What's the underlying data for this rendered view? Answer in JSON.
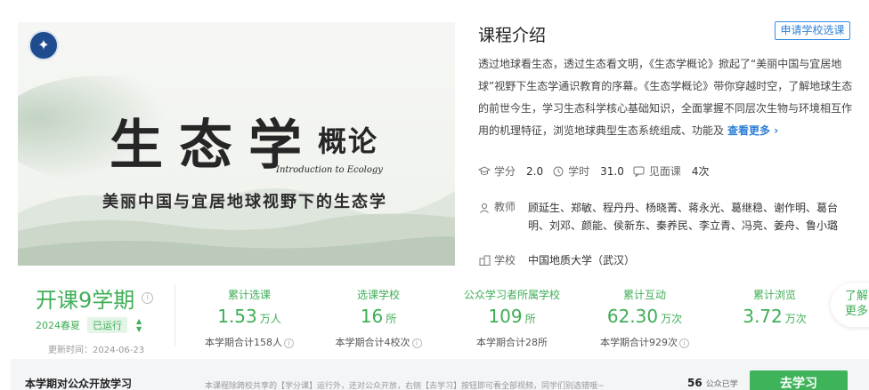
{
  "cover": {
    "logo_glyph": "✦",
    "title_main": "生态学",
    "title_small": "概论",
    "title_en": "Introduction to Ecology",
    "subtitle": "美丽中国与宜居地球视野下的生态学"
  },
  "intro": {
    "title": "课程介绍",
    "apply_button": "申请学校选课",
    "description": "透过地球看生态，透过生态看文明，《生态学概论》掀起了“美丽中国与宜居地球”视野下生态学通识教育的序幕。《生态学概论》带你穿越时空，了解地球生态的前世今生，学习生态科学核心基础知识，全面掌握不同层次生物与环境相互作用的机理特征，浏览地球典型生态系统组成、功能及",
    "more_link": "查看更多 ›"
  },
  "meta": {
    "credit_label": "学分",
    "credit_value": "2.0",
    "hours_label": "学时",
    "hours_value": "31.0",
    "meeting_label": "见面课",
    "meeting_value": "4次"
  },
  "teacher": {
    "label": "教师",
    "names": "顾延生、郑敏、程丹丹、杨晓菁、蒋永光、葛继稳、谢作明、葛台明、刘邓、颜能、侯新东、秦养民、李立青、冯亮、姜舟、鲁小璐"
  },
  "school": {
    "label": "学校",
    "value": "中国地质大学（武汉）"
  },
  "session": {
    "title": "开课9学期",
    "term": "2024春夏",
    "status": "已运行",
    "updated_label": "更新时间：",
    "updated_value": "2024-06-23"
  },
  "stats": [
    {
      "label": "累计选课",
      "value": "1.53",
      "unit": "万人",
      "sub": "本学期合计158人"
    },
    {
      "label": "选课学校",
      "value": "16",
      "unit": "所",
      "sub": "本学期合计4校次"
    },
    {
      "label": "公众学习者所属学校",
      "value": "109",
      "unit": "所",
      "sub": "本学期合计28所"
    },
    {
      "label": "累计互动",
      "value": "62.30",
      "unit": "万次",
      "sub": "本学期合计929次"
    },
    {
      "label": "累计浏览",
      "value": "3.72",
      "unit": "万次",
      "sub": ""
    }
  ],
  "side_more": {
    "line1": "了解",
    "line2": "更多"
  },
  "bottom": {
    "title": "本学期对公众开放学习",
    "note": "本课程除跨校共享的【学分课】运行外，还对公众开放，右侧【去学习】按钮即可看全部视频，同学们别选错哦~",
    "count": "56",
    "count_unit": "公众已学",
    "learn_button": "去学习"
  },
  "colors": {
    "green": "#3fae57",
    "blue": "#2f7fd8"
  }
}
